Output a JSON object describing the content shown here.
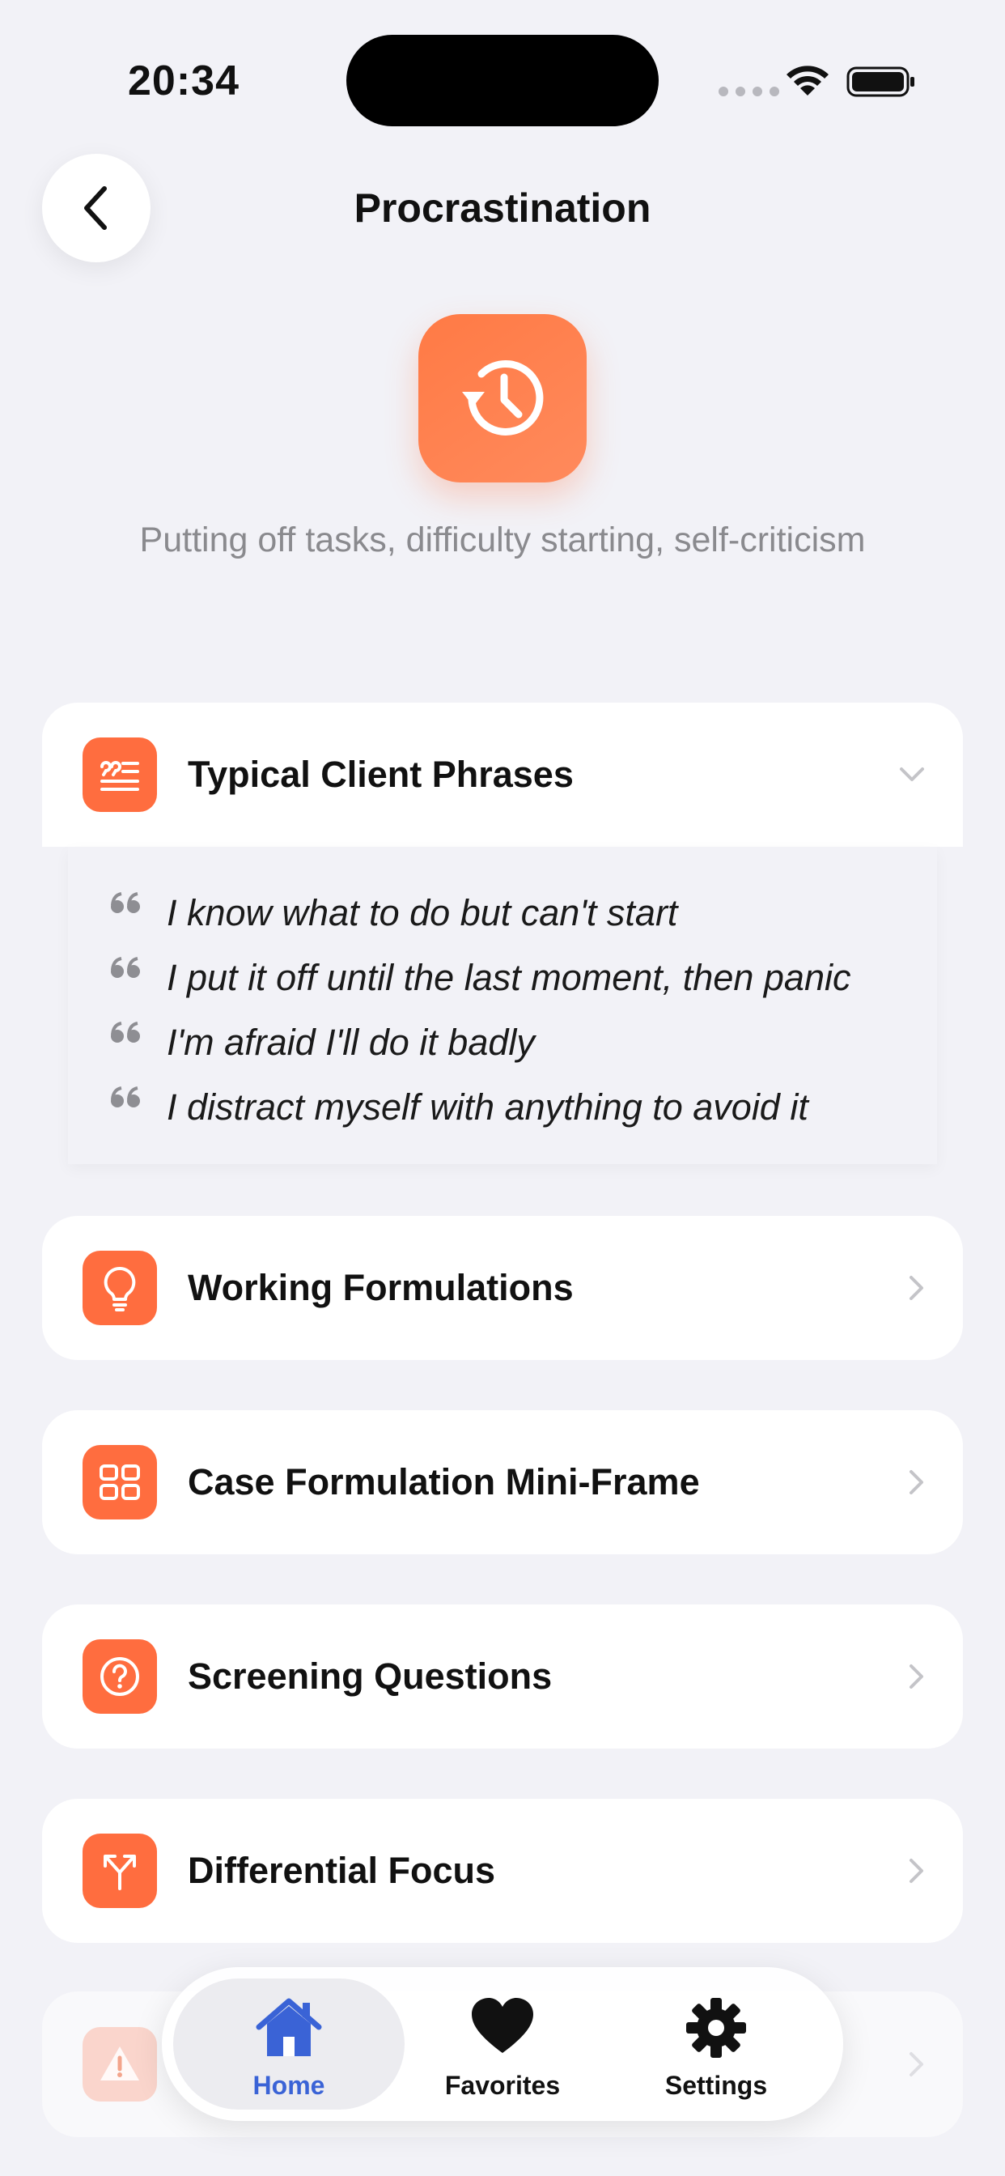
{
  "status_bar": {
    "time": "20:34"
  },
  "nav": {
    "title": "Procrastination"
  },
  "hero": {
    "icon": "clock-history-icon",
    "subtitle": "Putting off tasks, difficulty starting, self-criticism"
  },
  "sections": {
    "phrases": {
      "title": "Typical Client Phrases",
      "icon": "quote-list-icon",
      "expanded": true,
      "items": [
        "I know what to do but can't start",
        "I put it off until the last moment, then panic",
        "I'm afraid I'll do it badly",
        "I distract myself with anything to avoid it"
      ]
    },
    "formulations": {
      "title": "Working Formulations",
      "icon": "lightbulb-icon"
    },
    "mini_frame": {
      "title": "Case Formulation Mini-Frame",
      "icon": "grid-icon"
    },
    "screening": {
      "title": "Screening Questions",
      "icon": "question-circle-icon"
    },
    "differential": {
      "title": "Differential Focus",
      "icon": "fork-arrows-icon"
    },
    "hidden_item": {
      "icon": "warning-triangle-icon"
    }
  },
  "tabbar": {
    "tabs": [
      {
        "label": "Home",
        "icon": "house-icon",
        "active": true
      },
      {
        "label": "Favorites",
        "icon": "heart-icon",
        "active": false
      },
      {
        "label": "Settings",
        "icon": "gear-icon",
        "active": false
      }
    ]
  },
  "colors": {
    "accent": "#ff6d3f",
    "tab_active": "#3a63d6",
    "background": "#f2f2f7"
  }
}
